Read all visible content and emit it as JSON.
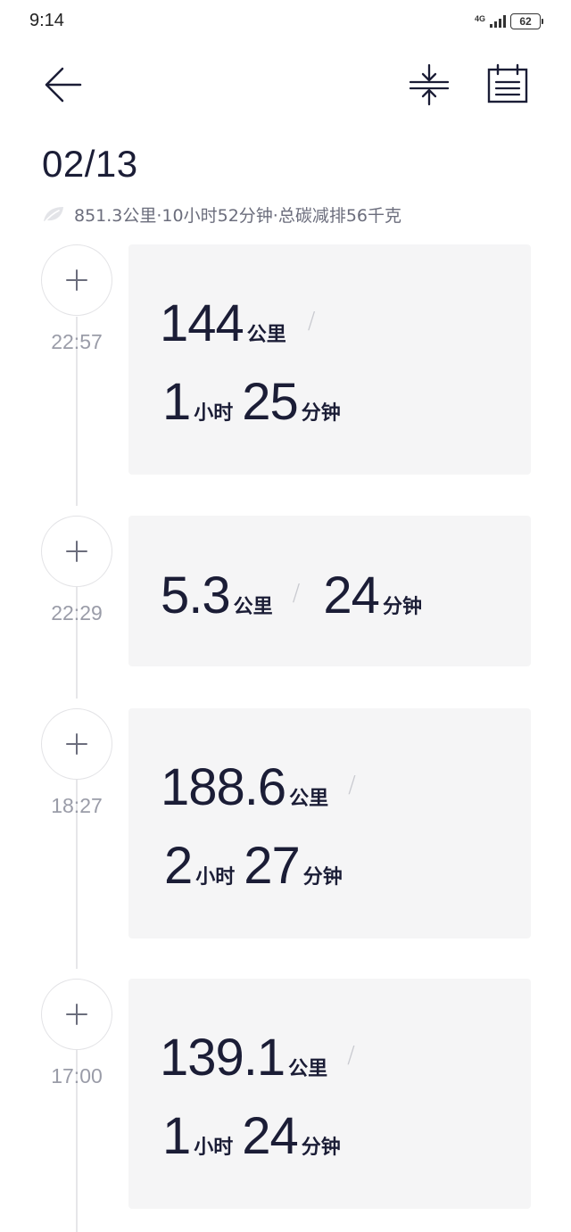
{
  "status_bar": {
    "time": "9:14",
    "network": "4G",
    "battery": "62"
  },
  "header": {
    "date": "02/13",
    "summary": "851.3公里·10小时52分钟·总碳减排56千克"
  },
  "trips": [
    {
      "time": "22:57",
      "distance": "144",
      "distance_unit": "公里",
      "separator": "/",
      "hours": "1",
      "hours_unit": "小时",
      "minutes": "25",
      "minutes_unit": "分钟"
    },
    {
      "time": "22:29",
      "distance": "5.3",
      "distance_unit": "公里",
      "separator": "/",
      "minutes": "24",
      "minutes_unit": "分钟"
    },
    {
      "time": "18:27",
      "distance": "188.6",
      "distance_unit": "公里",
      "separator": "/",
      "hours": "2",
      "hours_unit": "小时",
      "minutes": "27",
      "minutes_unit": "分钟"
    },
    {
      "time": "17:00",
      "distance": "139.1",
      "distance_unit": "公里",
      "separator": "/",
      "hours": "1",
      "hours_unit": "小时",
      "minutes": "24",
      "minutes_unit": "分钟"
    }
  ],
  "icons": {
    "back": "arrow-left-icon",
    "collapse": "collapse-vertical-icon",
    "calendar": "calendar-icon",
    "leaf": "leaf-icon",
    "expand": "plus-icon"
  },
  "colors": {
    "text": "#1b1d36",
    "muted": "#9a9ca8",
    "card": "#f5f5f6"
  }
}
